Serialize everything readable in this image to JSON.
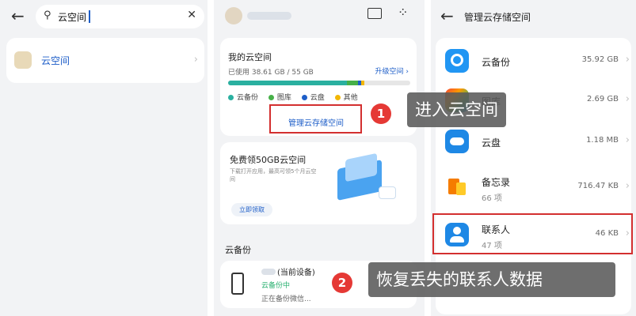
{
  "search_panel": {
    "query": "云空间",
    "result_label": "云空间"
  },
  "cloud_panel": {
    "title": "我的云空间",
    "usage": "已使用 38.61 GB / 55 GB",
    "upgrade": "升级空间",
    "legend": [
      {
        "label": "云备份",
        "color": "#2ab0a0"
      },
      {
        "label": "图库",
        "color": "#46b048"
      },
      {
        "label": "云盘",
        "color": "#1e5ec8"
      },
      {
        "label": "其他",
        "color": "#f2b705"
      }
    ],
    "manage": "管理云存储空间",
    "promo_title": "免费领50GB云空间",
    "promo_desc": "下载打开应用，最高可领5个月云空间",
    "promo_button": "立即领取",
    "section": "云备份",
    "device_label": "(当前设备)",
    "device_status": "云备份中",
    "device_progress": "正在备份微信..."
  },
  "manage_panel": {
    "title": "管理云存储空间",
    "items": [
      {
        "name": "云备份",
        "sub": "",
        "size": "35.92 GB"
      },
      {
        "name": "图库",
        "sub": "",
        "size": "2.69 GB"
      },
      {
        "name": "云盘",
        "sub": "",
        "size": "1.18 MB"
      },
      {
        "name": "备忘录",
        "sub": "66 项",
        "size": "716.47 KB"
      },
      {
        "name": "联系人",
        "sub": "47 项",
        "size": "46 KB"
      }
    ]
  },
  "annotations": {
    "step1_num": "1",
    "step1_text": "进入云空间",
    "step2_num": "2",
    "step2_text": "恢复丢失的联系人数据"
  }
}
